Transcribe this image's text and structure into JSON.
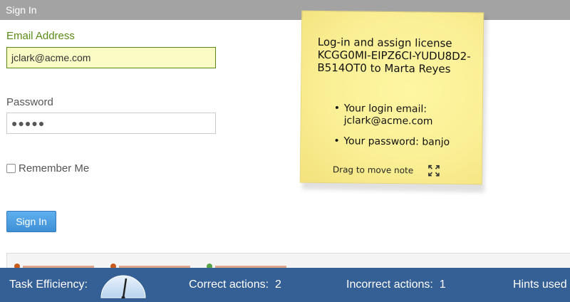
{
  "header": {
    "title": "Sign In"
  },
  "form": {
    "email_label": "Email Address",
    "email_value": "jclark@acme.com",
    "password_label": "Password",
    "password_masked": "●●●●●",
    "remember_label": "Remember Me",
    "submit_label": "Sign In"
  },
  "sticky_note": {
    "text": "Log-in and assign license KCGG0MI-EIPZ6CI-YUDU8D2-B514OT0 to Marta Reyes",
    "items": [
      "Your login email: jclark@acme.com",
      "Your password: banjo"
    ],
    "drag_hint": "Drag to move note"
  },
  "status_bar": {
    "efficiency_label": "Task Efficiency:",
    "correct_label": "Correct actions:",
    "correct_value": "2",
    "incorrect_label": "Incorrect actions:",
    "incorrect_value": "1",
    "hints_label": "Hints used"
  },
  "colors": {
    "header_bg": "#a3a3a3",
    "accent_green": "#5a8a16",
    "button_blue": "#3f8fd6",
    "status_bar_bg": "#356095",
    "note_yellow": "#faef95"
  },
  "icons": {
    "expand": "expand-arrows-icon",
    "gauge": "efficiency-gauge-icon"
  }
}
